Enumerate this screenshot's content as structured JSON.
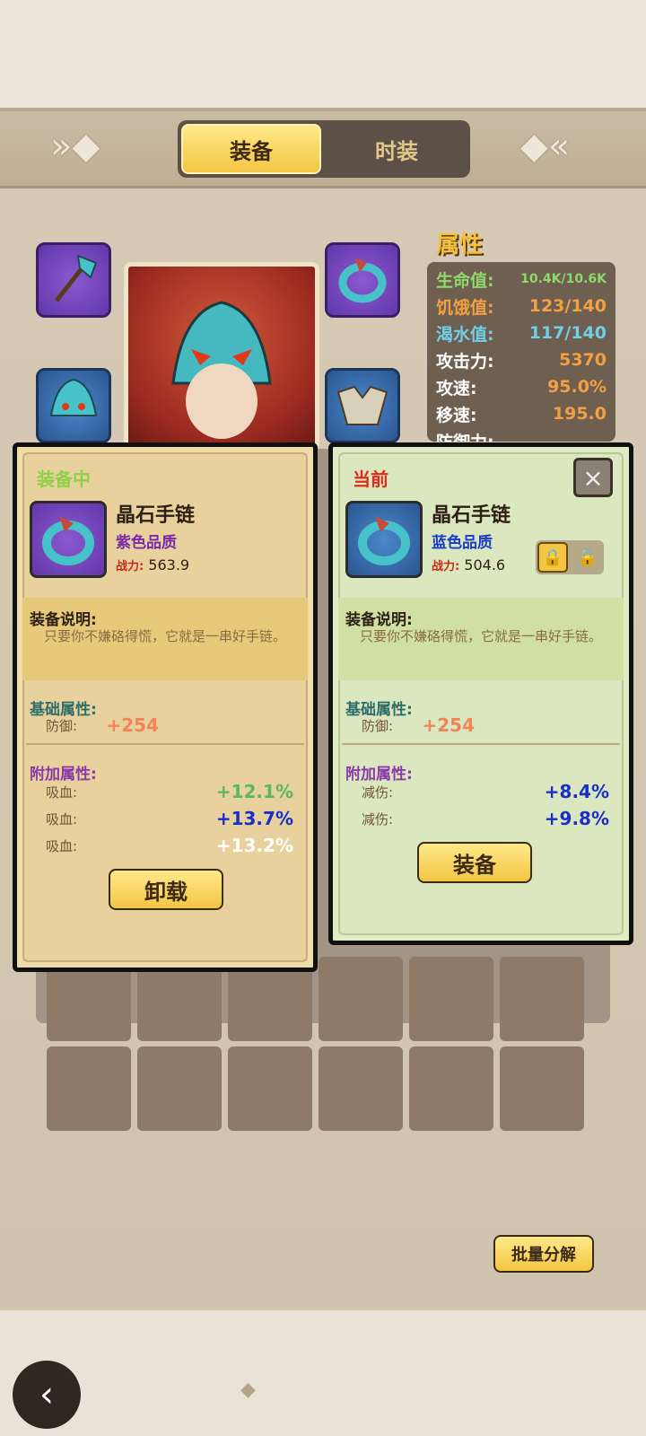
{
  "tabs": [
    {
      "label": "装备",
      "active": true
    },
    {
      "label": "时装",
      "active": false
    }
  ],
  "attributes": {
    "title": "属性",
    "rows": [
      {
        "key": "生命值:",
        "value": "10.4K/10.6K",
        "color": "#8fd86a",
        "valueColor": "#8fd86a"
      },
      {
        "key": "饥饿值:",
        "value": "123/140",
        "color": "#f2a042",
        "valueColor": "#f2a042"
      },
      {
        "key": "渴水值:",
        "value": "117/140",
        "color": "#6fd0e8",
        "valueColor": "#6fd0e8"
      },
      {
        "key": "攻击力:",
        "value": "5370",
        "color": "#ffffff",
        "valueColor": "#f2a042"
      },
      {
        "key": "攻速:",
        "value": "95.0%",
        "color": "#ffffff",
        "valueColor": "#f2a042"
      },
      {
        "key": "移速:",
        "value": "195.0",
        "color": "#ffffff",
        "valueColor": "#f2a042"
      },
      {
        "key": "防御力:",
        "value": "",
        "color": "#ffffff",
        "valueColor": "#f2a042"
      }
    ]
  },
  "left_card": {
    "status": "装备中",
    "status_color": "#8ed04a",
    "item_name": "晶石手链",
    "quality": "紫色品质",
    "quality_color": "#7a2aa8",
    "power_label": "战力:",
    "power_value": "563.9",
    "desc_title": "装备说明:",
    "desc": "只要你不嫌硌得慌，它就是一串好手链。",
    "basic_title": "基础属性:",
    "basic": [
      {
        "key": "防御:",
        "value": "+254",
        "color": "#f2845a"
      }
    ],
    "extra_title": "附加属性:",
    "extra": [
      {
        "key": "吸血:",
        "value": "+12.1%",
        "color": "#5cb85c"
      },
      {
        "key": "吸血:",
        "value": "+13.7%",
        "color": "#1a2fc8"
      },
      {
        "key": "吸血:",
        "value": "+13.2%",
        "color": "#ffffff"
      }
    ],
    "button": "卸载"
  },
  "right_card": {
    "status": "当前",
    "status_color": "#e02a1a",
    "item_name": "晶石手链",
    "quality": "蓝色品质",
    "quality_color": "#1a3ac8",
    "power_label": "战力:",
    "power_value": "504.6",
    "desc_title": "装备说明:",
    "desc": "只要你不嫌硌得慌，它就是一串好手链。",
    "basic_title": "基础属性:",
    "basic": [
      {
        "key": "防御:",
        "value": "+254",
        "color": "#f2845a"
      }
    ],
    "extra_title": "附加属性:",
    "extra": [
      {
        "key": "减伤:",
        "value": "+8.4%",
        "color": "#1a2fc8"
      },
      {
        "key": "减伤:",
        "value": "+9.8%",
        "color": "#1a2fc8"
      }
    ],
    "button": "装备",
    "close_icon": "×",
    "lock_icon": "🔒",
    "unlock_icon": "🔓"
  },
  "batch_button": "批量分解",
  "back_icon": "‹"
}
